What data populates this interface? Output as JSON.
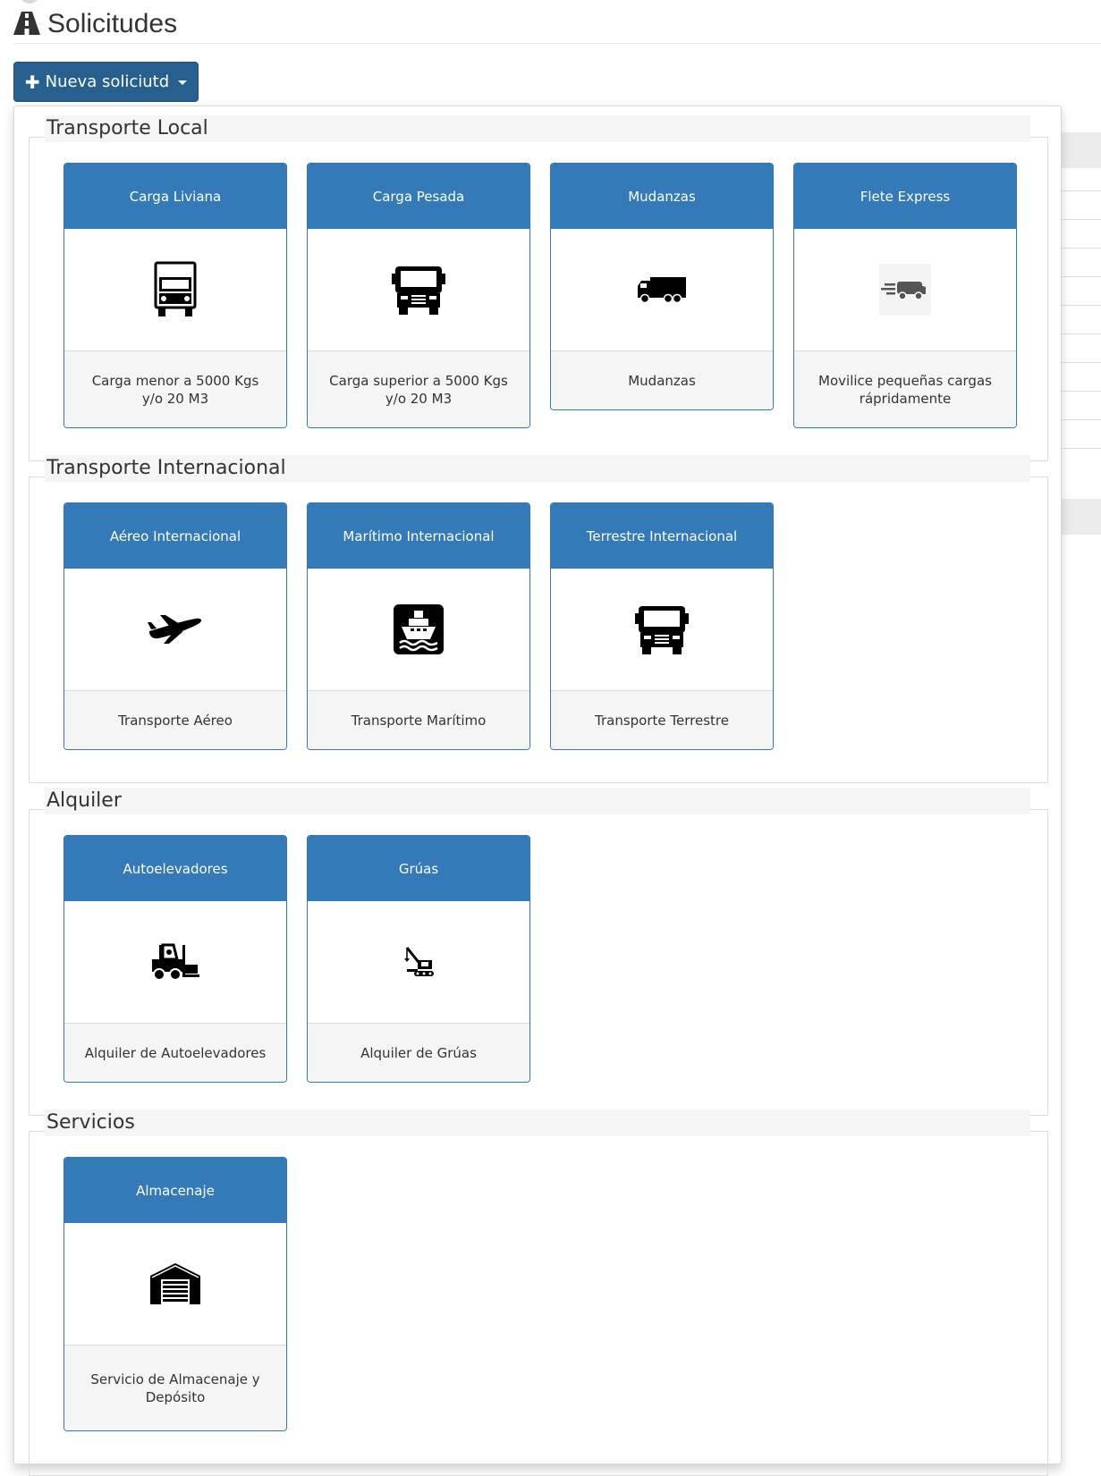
{
  "page": {
    "title": "Solicitudes",
    "title_icon": "road-icon"
  },
  "new_request_button": {
    "icon": "plus-icon",
    "label": "Nueva soliciutd",
    "caret": "caret-down-icon"
  },
  "groups": [
    {
      "title": "Transporte Local",
      "cards": [
        {
          "header": "Carga Liviana",
          "icon": "light-truck-icon",
          "description": "Carga menor a 5000 Kgs y/o 20 M3"
        },
        {
          "header": "Carga Pesada",
          "icon": "heavy-truck-icon",
          "description": "Carga superior a 5000 Kgs y/o 20 M3"
        },
        {
          "header": "Mudanzas",
          "icon": "moving-truck-icon",
          "description": "Mudanzas"
        },
        {
          "header": "Flete Express",
          "icon": "express-delivery-icon",
          "description": "Movilice pequeñas cargas rápridamente"
        }
      ]
    },
    {
      "title": "Transporte Internacional",
      "cards": [
        {
          "header": "Aéreo Internacional",
          "icon": "airplane-icon",
          "description": "Transporte Aéreo"
        },
        {
          "header": "Marítimo Internacional",
          "icon": "ship-icon",
          "description": "Transporte Marítimo"
        },
        {
          "header": "Terrestre Internacional",
          "icon": "truck-front-icon",
          "description": "Transporte Terrestre"
        }
      ]
    },
    {
      "title": "Alquiler",
      "cards": [
        {
          "header": "Autoelevadores",
          "icon": "forklift-icon",
          "description": "Alquiler de Autoelevadores"
        },
        {
          "header": "Grúas",
          "icon": "crane-icon",
          "description": "Alquiler de Grúas"
        }
      ]
    },
    {
      "title": "Servicios",
      "cards": [
        {
          "header": "Almacenaje",
          "icon": "warehouse-icon",
          "description": "Servicio de Almacenaje y Depósito"
        }
      ]
    }
  ],
  "colors": {
    "primary_button": "#27608f",
    "card_header": "#3479b8",
    "card_border": "#3277b6",
    "card_footer": "#f5f5f5"
  }
}
